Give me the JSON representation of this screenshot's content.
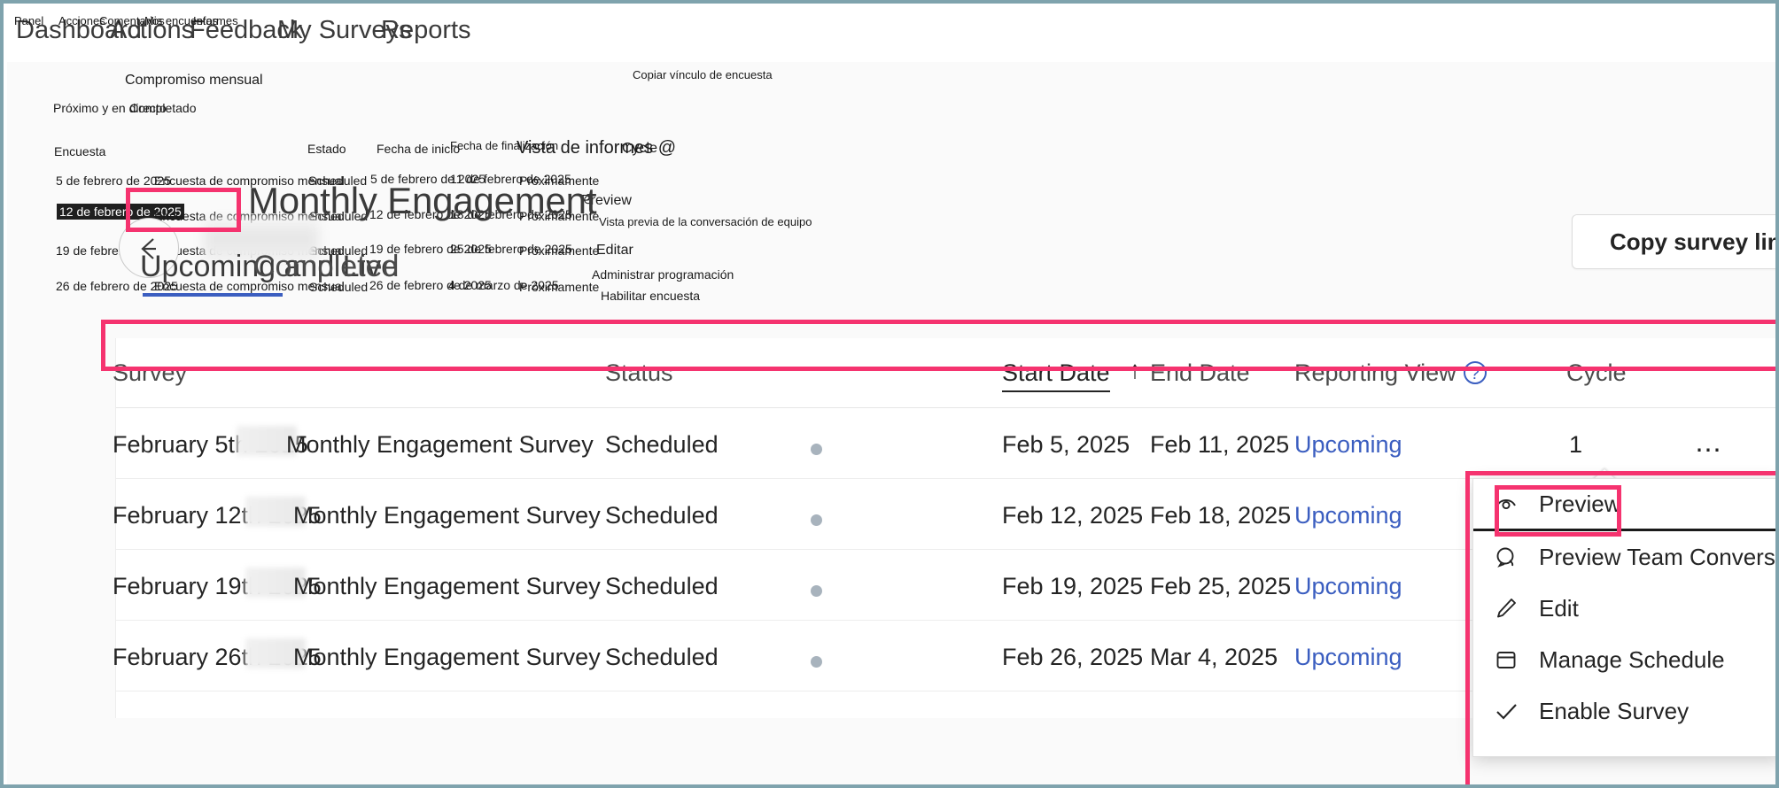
{
  "window": {
    "border_color": "#7fa3ad"
  },
  "topnav": {
    "items": [
      {
        "label": "Dashboard",
        "es": "Panel"
      },
      {
        "label": "Actions",
        "es": "Acciones"
      },
      {
        "label": "Feedback",
        "es": "Comentarios"
      },
      {
        "label": "My Surveys",
        "es": "Mis encuestas"
      },
      {
        "label": "Reports",
        "es": "Informes"
      }
    ]
  },
  "header": {
    "title": "Monthly Engagement",
    "title_es": "Compromiso mensual",
    "back_icon": "arrow-left-icon",
    "copy_link_label": "Copy survey link",
    "copy_link_icon": "link-icon",
    "copy_link_es": "Copiar vínculo de encuesta"
  },
  "tabs": [
    {
      "label": "Upcoming and Live",
      "es": "Próximo y en directo",
      "active": true
    },
    {
      "label": "Completed",
      "es": "Completado",
      "active": false
    }
  ],
  "table": {
    "columns": [
      {
        "label": "Survey",
        "es": "Encuesta",
        "sorted": false
      },
      {
        "label": "Status",
        "es": "Estado",
        "sorted": false
      },
      {
        "label": "Start Date",
        "es": "Fecha de inicio",
        "sorted": true,
        "sort_icon": "arrow-up-icon"
      },
      {
        "label": "End Date",
        "es": "Fecha de finalización",
        "sorted": false
      },
      {
        "label": "Reporting View",
        "es": "Vista de informes",
        "sorted": false,
        "help_icon": "question-mark-icon"
      },
      {
        "label": "Cycle",
        "es": "Ciclo",
        "sorted": false
      }
    ],
    "rows": [
      {
        "survey_prefix": "February 5th 2025",
        "survey_suffix": "Monthly Engagement Survey",
        "survey_es": "Encuesta de compromiso mensual",
        "date_es": "5 de febrero de 2025",
        "status": "Scheduled",
        "start_date": "Feb 5, 2025",
        "start_date_es": "5 de febrero de 2025",
        "end_date": "Feb 11, 2025",
        "end_date_es": "11 de febrero de 2025",
        "reporting_view": "Upcoming",
        "reporting_view_es": "Próximamente",
        "cycle": "1",
        "menu_icon": "more-options-icon",
        "selected": true
      },
      {
        "survey_prefix": "February 12th 2025",
        "survey_suffix": "Monthly Engagement Survey",
        "survey_es": "Encuesta de compromiso mensual",
        "date_es": "12 de febrero de 2025",
        "status": "Scheduled",
        "start_date": "Feb 12, 2025",
        "start_date_es": "12 de febrero de 2025",
        "end_date": "Feb 18, 2025",
        "end_date_es": "18 de febrero de 2025",
        "reporting_view": "Upcoming",
        "reporting_view_es": "Próximamente",
        "cycle": "",
        "menu_icon": "more-options-icon",
        "selected": false
      },
      {
        "survey_prefix": "February 19th 2025",
        "survey_suffix": "Monthly Engagement Survey",
        "survey_es": "Encuesta de compromiso mensual",
        "date_es": "19 de febrero de 2025",
        "status": "Scheduled",
        "start_date": "Feb 19, 2025",
        "start_date_es": "19 de febrero de 2025",
        "end_date": "Feb 25, 2025",
        "end_date_es": "25 de febrero de 2025",
        "reporting_view": "Upcoming",
        "reporting_view_es": "Próximamente",
        "cycle": "",
        "menu_icon": "more-options-icon",
        "selected": false
      },
      {
        "survey_prefix": "February 26th 2025",
        "survey_suffix": "Monthly Engagement Survey",
        "survey_es": "Encuesta de compromiso mensual",
        "date_es": "26 de febrero de 2025",
        "status": "Scheduled",
        "start_date": "Feb 26, 2025",
        "start_date_es": "26 de febrero de 2025",
        "end_date": "Mar 4, 2025",
        "end_date_es": "4 de marzo de 2025",
        "reporting_view": "Upcoming",
        "reporting_view_es": "Próximamente",
        "cycle": "",
        "menu_icon": "more-options-icon",
        "selected": false
      }
    ]
  },
  "context_menu": {
    "items": [
      {
        "label": "Preview",
        "es": "Preview",
        "icon": "eye-icon",
        "highlighted": true
      },
      {
        "label": "Preview Team Conversation",
        "es": "Vista previa de la conversación de equipo",
        "icon": "chat-bubble-icon",
        "highlighted": false
      },
      {
        "label": "Edit",
        "es": "Editar",
        "icon": "pencil-icon",
        "highlighted": false
      },
      {
        "label": "Manage Schedule",
        "es": "Administrar programación",
        "icon": "calendar-icon",
        "highlighted": false
      },
      {
        "label": "Enable Survey",
        "es": "Habilitar encuesta",
        "icon": "checkmark-icon",
        "highlighted": false
      }
    ]
  },
  "annotations": {
    "highlight_color": "#f5336f",
    "link_color": "#3b5ec0"
  }
}
